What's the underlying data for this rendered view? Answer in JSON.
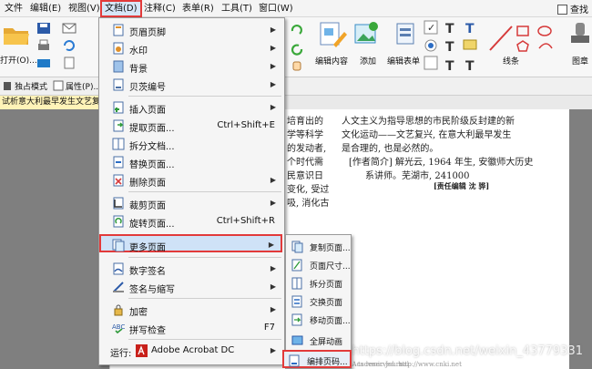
{
  "menubar": {
    "items": [
      "文件",
      "编辑(E)",
      "视图(V)",
      "文档(D)",
      "注释(C)",
      "表单(R)",
      "工具(T)",
      "窗口(W)"
    ],
    "right": "查找"
  },
  "ribbon": {
    "open_label": "打开(O)...",
    "edit_content": "编辑内容",
    "add": "添加",
    "edit_form": "编辑表单",
    "line": "线条",
    "stamp": "图章"
  },
  "toolbar": {
    "standalone_mode": "独占模式",
    "properties": "属性(P)..."
  },
  "tab": {
    "title": "试析意大利最早发生文艺复兴"
  },
  "document": {
    "left_lines": [
      "培育出的",
      "学等科学",
      "的发动者,",
      "个时代需",
      "民意识日",
      "变化, 受过",
      "吸, 消化古"
    ],
    "right_lines": [
      "人文主义为指导思想的市民阶级反封建的新",
      "文化运动——文艺复兴, 在意大利最早发生",
      "是合理的, 也是必然的。"
    ],
    "author_lines": [
      "[作者简介] 解光云, 1964 年生, 安徽师大历史",
      "系讲师。芜湖市, 241000"
    ],
    "editor": "[责任编辑  沈  骅]",
    "footer_left": "© 1994-2007 China Academic Journal",
    "footer_right": "ts reserved.   http://www.cnki.net"
  },
  "watermark": "https://blog.csdn.net/weixin_43779331",
  "menu": {
    "items": [
      {
        "label": "页眉页脚",
        "shortcut": "",
        "submenu": true
      },
      {
        "label": "水印",
        "shortcut": "",
        "submenu": true
      },
      {
        "label": "背景",
        "shortcut": "",
        "submenu": true
      },
      {
        "label": "贝茨编号",
        "shortcut": "",
        "submenu": true
      },
      {
        "label": "插入页面",
        "shortcut": "",
        "submenu": true
      },
      {
        "label": "提取页面...",
        "shortcut": "Ctrl+Shift+E",
        "submenu": false
      },
      {
        "label": "拆分文档...",
        "shortcut": "",
        "submenu": false
      },
      {
        "label": "替换页面...",
        "shortcut": "",
        "submenu": false
      },
      {
        "label": "删除页面",
        "shortcut": "",
        "submenu": true
      },
      {
        "label": "裁剪页面",
        "shortcut": "",
        "submenu": true
      },
      {
        "label": "旋转页面...",
        "shortcut": "Ctrl+Shift+R",
        "submenu": false
      },
      {
        "label": "更多页面",
        "shortcut": "",
        "submenu": true
      },
      {
        "label": "数字签名",
        "shortcut": "",
        "submenu": true
      },
      {
        "label": "签名与缩写",
        "shortcut": "",
        "submenu": true
      },
      {
        "label": "加密",
        "shortcut": "",
        "submenu": true
      },
      {
        "label": "拼写检查",
        "shortcut": "F7",
        "submenu": false
      },
      {
        "label": "运行:",
        "shortcut": "",
        "submenu": true
      }
    ],
    "run_target": "Adobe Acrobat DC"
  },
  "submenu": {
    "items": [
      "复制页面...",
      "页面尺寸...",
      "拆分页面",
      "交换页面",
      "移动页面...",
      "全屏动画",
      "编排页码..."
    ]
  },
  "colors": {
    "highlight_border": "#e23a3a",
    "menu_highlight": "#cfe2f7"
  }
}
